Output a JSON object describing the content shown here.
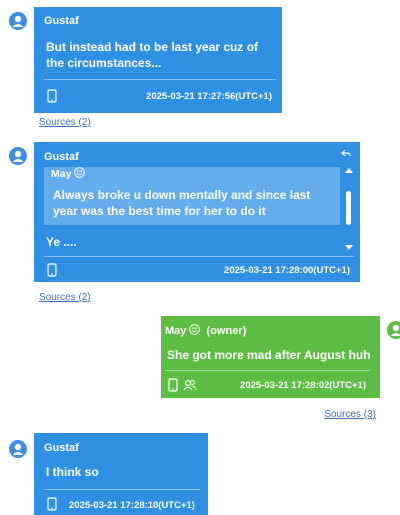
{
  "messages": [
    {
      "sender": "Gustaf",
      "text": "But instead had to be last year cuz of the circumstances...",
      "timestamp": "2025-03-21 17:27:56(UTC+1)",
      "sources": "Sources (2)"
    },
    {
      "sender": "Gustaf",
      "quote_sender": "May",
      "quote_text": "Always broke u down mentally and since last year was the best time for her to do it",
      "text": "Ye ....",
      "timestamp": "2025-03-21 17:28:00(UTC+1)",
      "sources": "Sources (2)"
    },
    {
      "sender": "May",
      "owner_label": "(owner)",
      "text": "She got more mad after August huh",
      "timestamp": "2025-03-21 17:28:02(UTC+1)",
      "sources": "Sources (3)"
    },
    {
      "sender": "Gustaf",
      "text": "I think so",
      "timestamp": "2025-03-21 17:28:10(UTC+1)"
    }
  ],
  "colors": {
    "incoming_bubble": "#2f8fe3",
    "outgoing_bubble": "#5cbd44",
    "quote_box": "#64abec",
    "link": "#3b6fb5"
  }
}
